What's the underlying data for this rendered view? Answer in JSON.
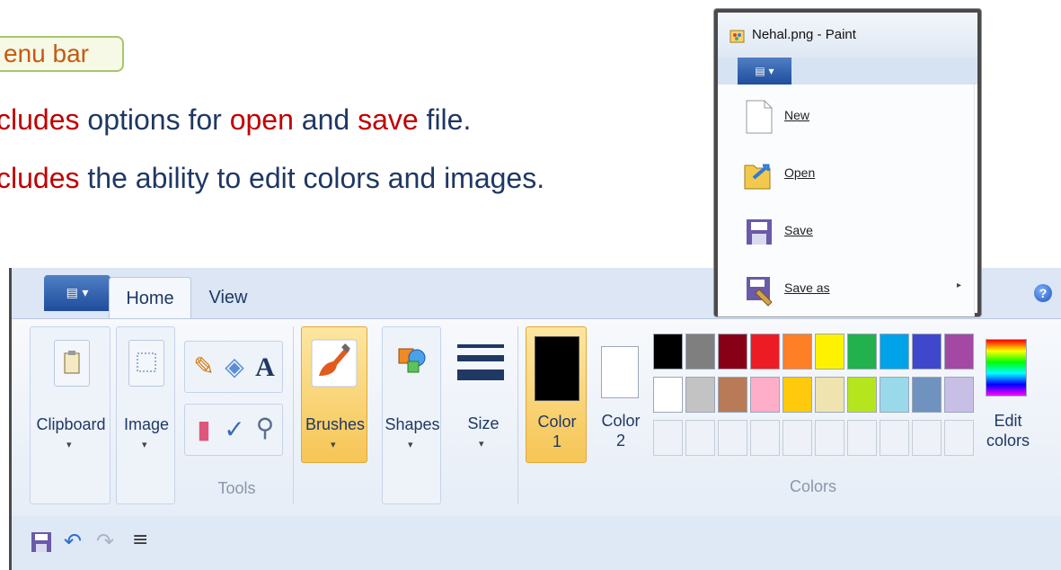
{
  "slide": {
    "badge": "enu bar",
    "bullet1": {
      "part1": "cludes",
      "part2": " options for ",
      "part3": "open",
      "part4": " and ",
      "part5": "save",
      "part6": " file."
    },
    "bullet2": {
      "part1": "cludes",
      "part2": " the ability to edit colors and images."
    }
  },
  "ribbon": {
    "tabs": {
      "home": "Home",
      "view": "View"
    },
    "help": "?",
    "groups": {
      "clipboard": "Clipboard",
      "image": "Image",
      "tools": "Tools",
      "brushes": "Brushes",
      "shapes": "Shapes",
      "size": "Size",
      "color1_line1": "Color",
      "color1_line2": "1",
      "color2_line1": "Color",
      "color2_line2": "2",
      "colors": "Colors",
      "edit_line1": "Edit",
      "edit_line2": "colors"
    },
    "palette_row1": [
      "#000000",
      "#7f7f7f",
      "#880015",
      "#ed1c24",
      "#ff7f27",
      "#fff200",
      "#22b14c",
      "#00a2e8",
      "#3f48cc",
      "#a349a4"
    ],
    "palette_row2": [
      "#ffffff",
      "#c3c3c3",
      "#b97a57",
      "#ffaec9",
      "#ffc90e",
      "#efe4b0",
      "#b5e61d",
      "#99d9ea",
      "#7092be",
      "#c8bfe7"
    ]
  },
  "dropdown": {
    "title": "Nehal.png - Paint",
    "items": [
      {
        "label": "New"
      },
      {
        "label": "Open"
      },
      {
        "label": "Save"
      },
      {
        "label": "Save as"
      }
    ]
  }
}
